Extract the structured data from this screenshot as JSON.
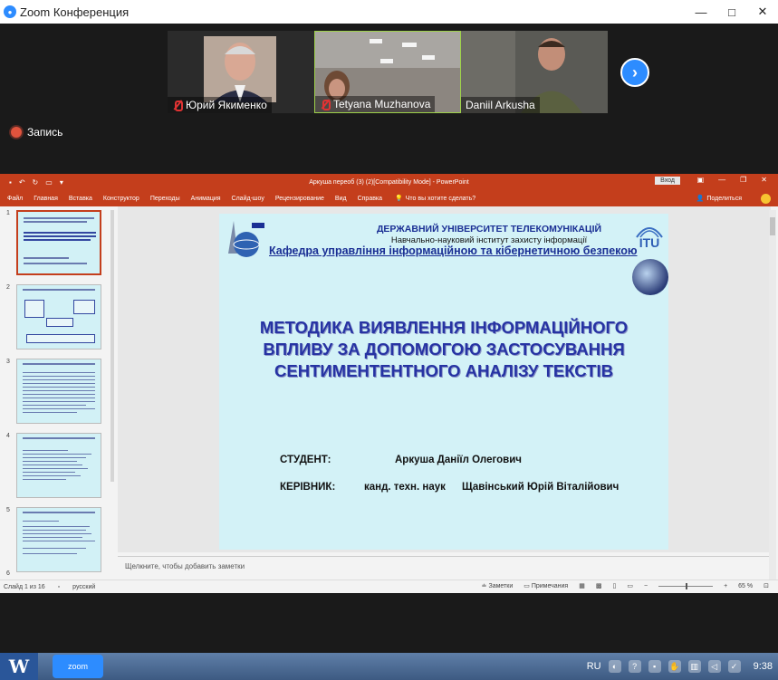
{
  "zoom": {
    "window_title": "Zoom Конференция",
    "window_controls": {
      "minimize": "—",
      "maximize": "□",
      "close": "✕"
    },
    "participants": [
      {
        "name": "Юрий Якименко",
        "muted": true
      },
      {
        "name": "Tetyana Muzhanova",
        "muted": true
      },
      {
        "name": "Daniil Arkusha",
        "muted": false
      }
    ],
    "next_arrow": "›",
    "record_label": "Запись"
  },
  "powerpoint": {
    "doc_title": "Аркуша переоб (3) (2)[Compatibility Mode] - PowerPoint",
    "signin_label": "Вход",
    "ribbon_tabs": [
      "Файл",
      "Главная",
      "Вставка",
      "Конструктор",
      "Переходы",
      "Анимация",
      "Слайд-шоу",
      "Рецензирование",
      "Вид",
      "Справка"
    ],
    "tell_me": "Что вы хотите сделать?",
    "share_label": "Поделиться",
    "thumbnail_numbers": [
      "1",
      "2",
      "3",
      "4",
      "5",
      "6"
    ],
    "slide": {
      "university": "ДЕРЖАВНИЙ УНІВЕРСИТЕТ ТЕЛЕКОМУНІКАЦІЙ",
      "institute": "Навчально-науковий інститут захисту інформації",
      "department": "Кафедра управління інформаційною та кібернетичною безпекою",
      "itu_logo_text": "ITU",
      "title_lines": [
        "МЕТОДИКА ВИЯВЛЕННЯ ІНФОРМАЦІЙНОГО",
        "ВПЛИВУ ЗА ДОПОМОГОЮ ЗАСТОСУВАННЯ",
        "СЕНТИМЕНТЕНТНОГО АНАЛІЗУ ТЕКСТІВ"
      ],
      "student_label": "СТУДЕНТ:",
      "student_name": "Аркуша Даніїл Олегович",
      "supervisor_label": "КЕРІВНИК:",
      "supervisor_degree": "канд. техн. наук",
      "supervisor_name": "Щавінський Юрій Віталійович"
    },
    "notes_placeholder": "Щелкните, чтобы добавить заметки",
    "status": {
      "slide_count": "Слайд 1 из 16",
      "language": "русский",
      "notes_btn": "Заметки",
      "comments_btn": "Примечания",
      "zoom_level": "65 %"
    }
  },
  "taskbar": {
    "word_label": "W",
    "zoom_label": "zoom",
    "language": "RU",
    "time": "9:38"
  },
  "colors": {
    "ppt_accent": "#c43e1c",
    "zoom_blue": "#2d8cff",
    "slide_bg": "#d3f2f7",
    "slide_title": "#2633a3"
  }
}
